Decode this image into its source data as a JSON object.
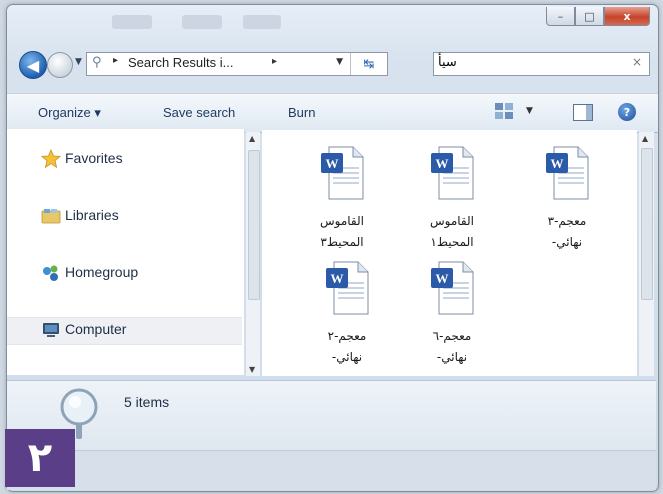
{
  "window": {
    "caption_buttons": {
      "minimize": "–",
      "maximize": "□",
      "close": "x"
    }
  },
  "address_bar": {
    "path": "Search Results i...",
    "separator": "▸",
    "search_query": "سيأ",
    "refresh_icon": "refresh-icon"
  },
  "toolbar": {
    "organize_label": "Organize ▾",
    "save_search_label": "Save search",
    "burn_label": "Burn"
  },
  "nav_pane": {
    "items": [
      {
        "label": "Favorites",
        "icon": "star-icon"
      },
      {
        "label": "Libraries",
        "icon": "libraries-icon"
      },
      {
        "label": "Homegroup",
        "icon": "homegroup-icon"
      },
      {
        "label": "Computer",
        "icon": "computer-icon",
        "selected": true
      }
    ]
  },
  "files": [
    {
      "line1": "القاموس",
      "line2": "المحيط٣",
      "icon": "word-document-icon"
    },
    {
      "line1": "القاموس",
      "line2": "المحيط١",
      "icon": "word-document-icon"
    },
    {
      "line1": "معجم-٣",
      "line2": "نهائي-",
      "icon": "word-document-icon"
    },
    {
      "line1": "معجم-٢",
      "line2": "نهائي-",
      "icon": "word-document-icon"
    },
    {
      "line1": "معجم-٦",
      "line2": "نهائي-",
      "icon": "word-document-icon"
    }
  ],
  "details": {
    "item_count": "5 items"
  },
  "step_badge": {
    "number": "٢",
    "color": "#5a3f88"
  }
}
